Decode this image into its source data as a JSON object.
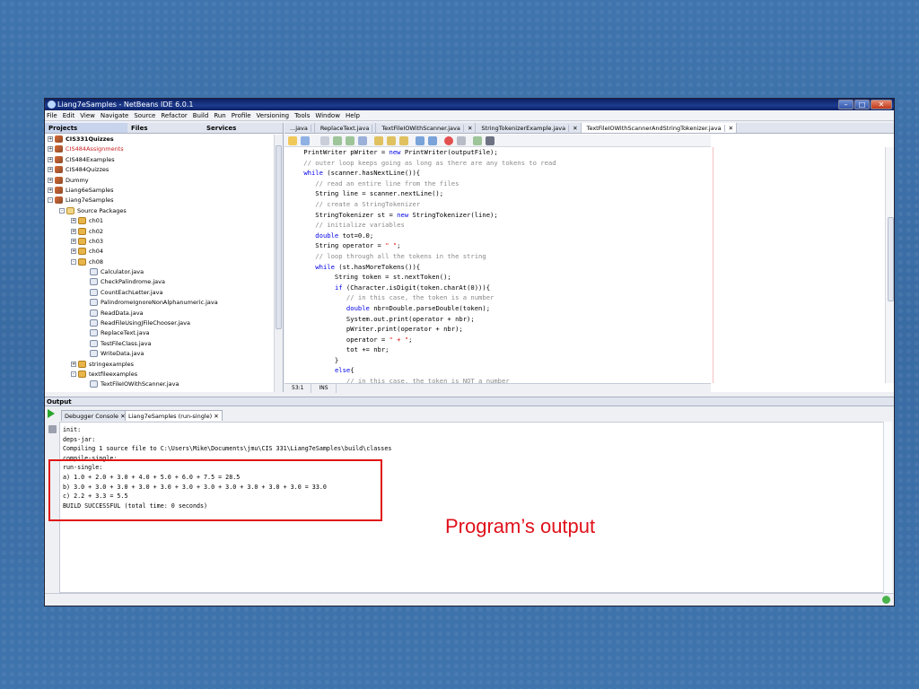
{
  "window": {
    "title": "Liang7eSamples - NetBeans IDE 6.0.1"
  },
  "menubar": [
    "File",
    "Edit",
    "View",
    "Navigate",
    "Source",
    "Refactor",
    "Build",
    "Run",
    "Profile",
    "Versioning",
    "Tools",
    "Window",
    "Help"
  ],
  "left_pane": {
    "tabs": [
      "Projects",
      "Files",
      "Services"
    ],
    "tree": [
      {
        "label": "CIS331Quizzes",
        "indent": 0,
        "icon": "project-icon",
        "exp": "+",
        "style": "bold"
      },
      {
        "label": "CIS484Assignments",
        "indent": 0,
        "icon": "project-icon",
        "exp": "+",
        "style": "red"
      },
      {
        "label": "CIS484Examples",
        "indent": 0,
        "icon": "project-icon",
        "exp": "+",
        "style": ""
      },
      {
        "label": "CIS484Quizzes",
        "indent": 0,
        "icon": "project-icon",
        "exp": "+",
        "style": ""
      },
      {
        "label": "Dummy",
        "indent": 0,
        "icon": "project-icon",
        "exp": "+",
        "style": ""
      },
      {
        "label": "Liang6eSamples",
        "indent": 0,
        "icon": "project-icon",
        "exp": "+",
        "style": ""
      },
      {
        "label": "Liang7eSamples",
        "indent": 0,
        "icon": "project-icon",
        "exp": "-",
        "style": ""
      },
      {
        "label": "Source Packages",
        "indent": 1,
        "icon": "source-folder-icon",
        "exp": "-",
        "style": ""
      },
      {
        "label": "ch01",
        "indent": 2,
        "icon": "package-icon",
        "exp": "+",
        "style": ""
      },
      {
        "label": "ch02",
        "indent": 2,
        "icon": "package-icon",
        "exp": "+",
        "style": ""
      },
      {
        "label": "ch03",
        "indent": 2,
        "icon": "package-icon",
        "exp": "+",
        "style": ""
      },
      {
        "label": "ch04",
        "indent": 2,
        "icon": "package-icon",
        "exp": "+",
        "style": ""
      },
      {
        "label": "ch08",
        "indent": 2,
        "icon": "package-icon",
        "exp": "-",
        "style": ""
      },
      {
        "label": "Calculator.java",
        "indent": 3,
        "icon": "java-file-icon",
        "exp": "",
        "style": ""
      },
      {
        "label": "CheckPalindrome.java",
        "indent": 3,
        "icon": "java-file-icon",
        "exp": "",
        "style": ""
      },
      {
        "label": "CountEachLetter.java",
        "indent": 3,
        "icon": "java-file-icon",
        "exp": "",
        "style": ""
      },
      {
        "label": "PalindromeIgnoreNonAlphanumeric.java",
        "indent": 3,
        "icon": "java-file-icon",
        "exp": "",
        "style": ""
      },
      {
        "label": "ReadData.java",
        "indent": 3,
        "icon": "java-file-icon",
        "exp": "",
        "style": ""
      },
      {
        "label": "ReadFileUsingJFileChooser.java",
        "indent": 3,
        "icon": "java-file-icon",
        "exp": "",
        "style": ""
      },
      {
        "label": "ReplaceText.java",
        "indent": 3,
        "icon": "java-file-icon",
        "exp": "",
        "style": ""
      },
      {
        "label": "TestFileClass.java",
        "indent": 3,
        "icon": "java-file-icon",
        "exp": "",
        "style": ""
      },
      {
        "label": "WriteData.java",
        "indent": 3,
        "icon": "java-file-icon",
        "exp": "",
        "style": ""
      },
      {
        "label": "stringexamples",
        "indent": 2,
        "icon": "package-icon",
        "exp": "+",
        "style": ""
      },
      {
        "label": "textfileexamples",
        "indent": 2,
        "icon": "package-icon",
        "exp": "-",
        "style": ""
      },
      {
        "label": "TextFileIOWithScanner.java",
        "indent": 3,
        "icon": "java-file-icon",
        "exp": "",
        "style": ""
      }
    ]
  },
  "editor": {
    "tabs": [
      "...java",
      "ReplaceText.java",
      "TextFileIOWithScanner.java",
      "StringTokenizerExample.java",
      "TextFileIOWithScannerAndStringTokenizer.java"
    ],
    "lines": [
      [
        [
          "    PrintWriter pWriter = ",
          ""
        ],
        [
          "new",
          "kw"
        ],
        [
          " PrintWriter(outputFile);",
          ""
        ]
      ],
      [
        [
          "    // outer loop keeps going as long as there are any tokens to read",
          "cm"
        ]
      ],
      [
        [
          "    ",
          ""
        ],
        [
          "while",
          "kw"
        ],
        [
          " (scanner.hasNextLine()){",
          ""
        ]
      ],
      [
        [
          "       // read an entire line from the files",
          "cm"
        ]
      ],
      [
        [
          "       String line = scanner.nextLine();",
          ""
        ]
      ],
      [
        [
          "       // create a StringTokenizer",
          "cm"
        ]
      ],
      [
        [
          "       StringTokenizer st = ",
          ""
        ],
        [
          "new",
          "kw"
        ],
        [
          " StringTokenizer(line);",
          ""
        ]
      ],
      [
        [
          "       // initialize variables",
          "cm"
        ]
      ],
      [
        [
          "       ",
          ""
        ],
        [
          "double",
          "kw"
        ],
        [
          " tot=0.0;",
          ""
        ]
      ],
      [
        [
          "       String operator = ",
          ""
        ],
        [
          "\" \"",
          "st"
        ],
        [
          ";",
          ""
        ]
      ],
      [
        [
          "       // loop through all the tokens in the string",
          "cm"
        ]
      ],
      [
        [
          "       ",
          ""
        ],
        [
          "while",
          "kw"
        ],
        [
          " (st.hasMoreTokens()){",
          ""
        ]
      ],
      [
        [
          "            String token = st.nextToken();",
          ""
        ]
      ],
      [
        [
          "            ",
          ""
        ],
        [
          "if",
          "kw"
        ],
        [
          " (Character.isDigit(token.charAt(0))){",
          ""
        ]
      ],
      [
        [
          "               // in this case, the token is a number",
          "cm"
        ]
      ],
      [
        [
          "               ",
          ""
        ],
        [
          "double",
          "kw"
        ],
        [
          " nbr=Double.parseDouble(token);",
          ""
        ]
      ],
      [
        [
          "               System.out.print(operator + nbr);",
          ""
        ]
      ],
      [
        [
          "               pWriter.print(operator + nbr);",
          ""
        ]
      ],
      [
        [
          "               operator = ",
          ""
        ],
        [
          "\" + \"",
          "st"
        ],
        [
          ";",
          ""
        ]
      ],
      [
        [
          "               tot += nbr;",
          ""
        ]
      ],
      [
        [
          "            }",
          ""
        ]
      ],
      [
        [
          "            ",
          ""
        ],
        [
          "else",
          "kw"
        ],
        [
          "{",
          ""
        ]
      ],
      [
        [
          "               // in this case, the token is NOT a number",
          "cm"
        ]
      ]
    ],
    "status": {
      "position": "53:1",
      "mode": "INS"
    }
  },
  "output": {
    "title": "Output",
    "tabs": [
      "Debugger Console",
      "Liang7eSamples (run-single)"
    ],
    "lines": [
      "init:",
      "deps-jar:",
      "Compiling 1 source file to C:\\Users\\Mike\\Documents\\jmu\\CIS 331\\Liang7eSamples\\build\\classes",
      "compile-single:",
      "run-single:",
      "a) 1.0 + 2.0 + 3.0 + 4.0 + 5.0 + 6.0 + 7.5 = 28.5",
      "b) 3.0 + 3.0 + 3.0 + 3.0 + 3.0 + 3.0 + 3.0 + 3.0 + 3.0 + 3.0 + 3.0 = 33.0",
      "c) 2.2 + 3.3 = 5.5",
      "BUILD SUCCESSFUL (total time: 0 seconds)"
    ]
  },
  "annotation": {
    "text": "Program’s output",
    "color": "#e0101a"
  }
}
